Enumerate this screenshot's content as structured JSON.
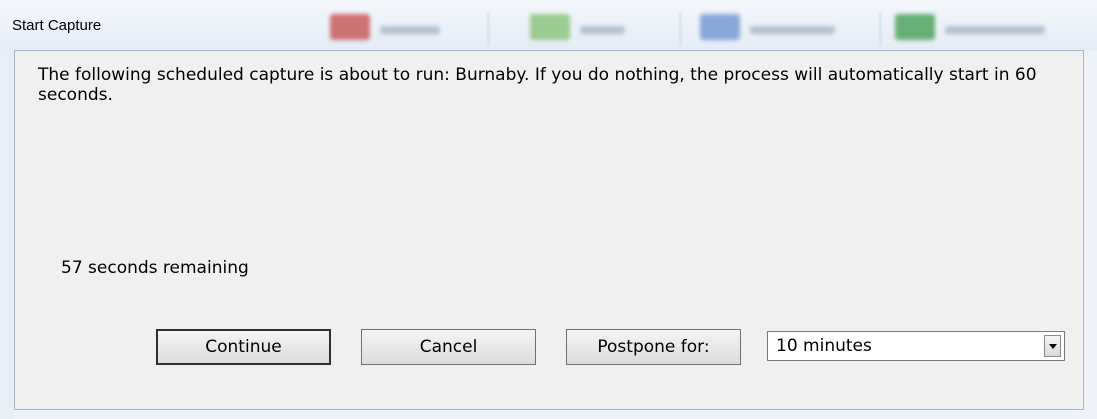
{
  "window": {
    "title": "Start Capture"
  },
  "dialog": {
    "message": "The following scheduled capture is about to run: Burnaby. If you do nothing, the process will automatically start in 60 seconds.",
    "countdown": "57 seconds remaining"
  },
  "buttons": {
    "continue_label": "Continue",
    "cancel_label": "Cancel",
    "postpone_label": "Postpone for:"
  },
  "postpone_select": {
    "selected": "10 minutes"
  },
  "colors": {
    "dialog_bg": "#f0f0f0",
    "frame_bg": "#eef3f9",
    "border": "#aab4c3"
  }
}
